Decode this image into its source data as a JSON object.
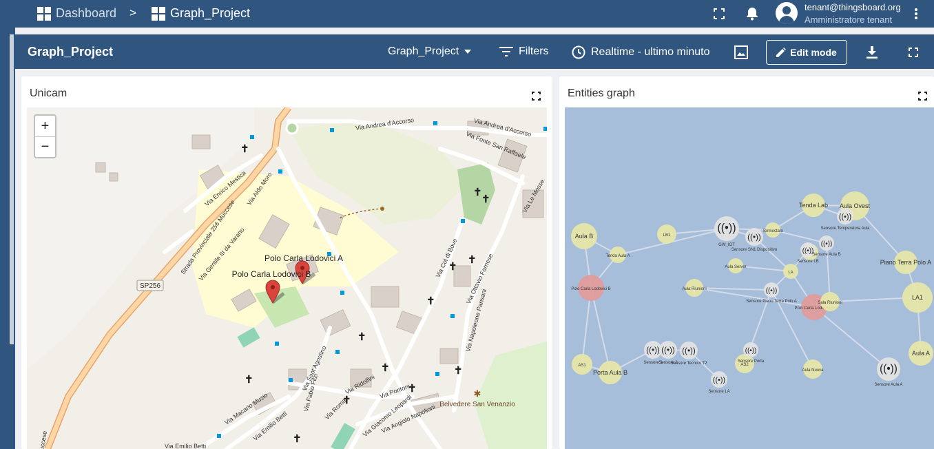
{
  "breadcrumb": {
    "home_label": "Dashboard",
    "separator": ">",
    "current_label": "Graph_Project"
  },
  "user": {
    "email": "tenant@thingsboard.org",
    "role": "Amministratore tenant"
  },
  "toolbar": {
    "title": "Graph_Project",
    "state_select": "Graph_Project",
    "filters_label": "Filters",
    "timewindow_label": "Realtime - ultimo minuto",
    "edit_mode_label": "Edit mode"
  },
  "map_widget": {
    "title": "Unicam",
    "zoom_in": "+",
    "zoom_out": "−",
    "markers": [
      "Polo Carla Lodovici A",
      "Polo Carla Lodovici B"
    ],
    "road_shield": "SP256",
    "street_labels": [
      "Via Andrea d'Accorso",
      "Via Andrea d'Accorso",
      "Via Fonte San Raffaele",
      "Via Enrico Mestica",
      "Via Aldo Moro",
      "Strada Provinciale 256 Muccese",
      "Via Gentile III da Varano",
      "Via Le Mosse",
      "Via Col di Bove",
      "Via Ottavio Farnese",
      "Via Napoleone Parisani",
      "Via Sant'Agostino",
      "Via Fabio Filzi",
      "Via Ridolfini",
      "Via Pontoni",
      "Via Roma",
      "Via Giacomo Leopardi",
      "Via Angiolo Napolioni",
      "Via Macario Muzio",
      "Via Emilio Betti",
      "Via Emilio Betti",
      "Muccese"
    ],
    "poi_label": "Belvedere San Venanzio"
  },
  "graph_widget": {
    "title": "Entities graph",
    "node_labels": [
      "Aula B",
      "LB1",
      "Tenda Aula A",
      "GW_IOT",
      "Sensore SN1 Dispositivo",
      "Termostato",
      "Aula Server",
      "Polo Carla Lodovici B",
      "LB",
      "LA",
      "Aula Riunioni",
      "Polo Carla Lodovici A",
      "Sala Riunioni",
      "Tenda Lab",
      "Aula Ovest",
      "Piano Terra Polo A",
      "LA1",
      "AS1",
      "Porta Aula B",
      "Sensore Tecnico T2",
      "AS2",
      "Aula A",
      "Aula Nuova",
      "Sensore 1",
      "Sensore 2",
      "Sensore Temperatura Aula",
      "Sensore LB",
      "Sensore LA",
      "Sensore Aula B",
      "Sensore Aula A",
      "Sensore Porta",
      "Sensore Piano Terra Polo A"
    ]
  },
  "colors": {
    "header": "#305680",
    "graph_bg": "#a7bedb",
    "node_asset": "#e6e6a9",
    "node_device": "#e2e2e2",
    "node_building": "#e09c9c"
  }
}
